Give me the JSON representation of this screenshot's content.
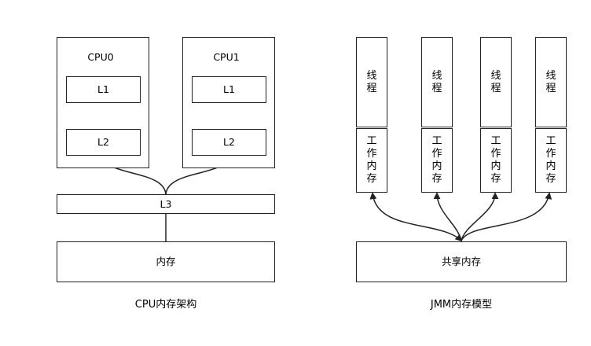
{
  "cpu": {
    "cpus": [
      {
        "name": "CPU0",
        "l1": "L1",
        "l2": "L2"
      },
      {
        "name": "CPU1",
        "l1": "L1",
        "l2": "L2"
      }
    ],
    "l3": "L3",
    "memory": "内存",
    "caption": "CPU内存架构"
  },
  "jmm": {
    "threads": [
      {
        "thread": [
          "线",
          "程"
        ],
        "work_mem": [
          "工",
          "作",
          "内",
          "存"
        ]
      },
      {
        "thread": [
          "线",
          "程"
        ],
        "work_mem": [
          "工",
          "作",
          "内",
          "存"
        ]
      },
      {
        "thread": [
          "线",
          "程"
        ],
        "work_mem": [
          "工",
          "作",
          "内",
          "存"
        ]
      },
      {
        "thread": [
          "线",
          "程"
        ],
        "work_mem": [
          "工",
          "作",
          "内",
          "存"
        ]
      }
    ],
    "shared_memory": "共享内存",
    "caption": "JMM内存模型"
  }
}
